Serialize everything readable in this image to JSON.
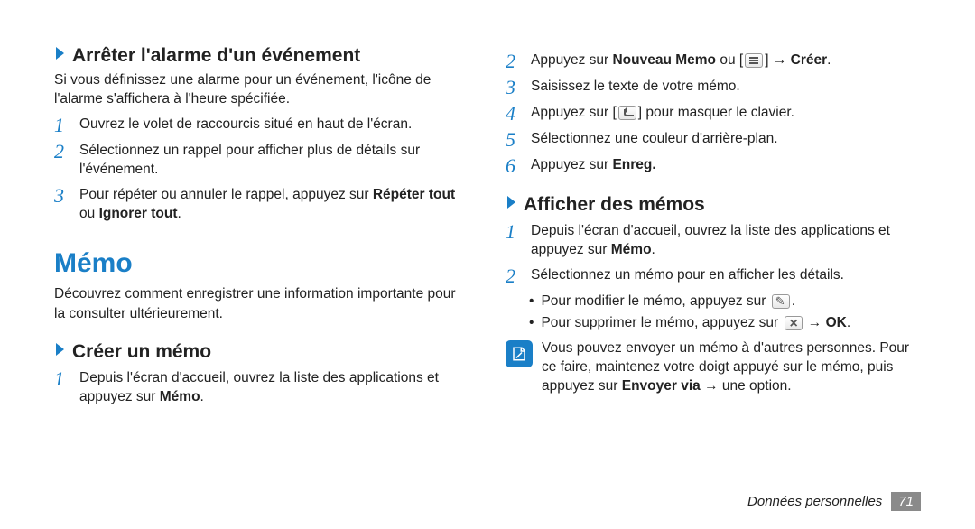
{
  "left": {
    "section1": {
      "heading": "Arrêter l'alarme d'un événement",
      "intro": "Si vous définissez une alarme pour un événement, l'icône de l'alarme s'affichera à l'heure spécifiée.",
      "steps": [
        {
          "num": "1",
          "text": "Ouvrez le volet de raccourcis situé en haut de l'écran."
        },
        {
          "num": "2",
          "text": "Sélectionnez un rappel pour afficher plus de détails sur l'événement."
        },
        {
          "num": "3",
          "prefix": "Pour répéter ou annuler le rappel, appuyez sur ",
          "bold1": "Répéter tout",
          "mid": " ou ",
          "bold2": "Ignorer tout",
          "suffix": "."
        }
      ]
    },
    "major": "Mémo",
    "majorIntro": "Découvrez comment enregistrer une information importante pour la consulter ultérieurement.",
    "section2": {
      "heading": "Créer un mémo",
      "steps": [
        {
          "num": "1",
          "prefix": "Depuis l'écran d'accueil, ouvrez la liste des applications et appuyez sur ",
          "bold1": "Mémo",
          "suffix": "."
        }
      ]
    }
  },
  "right": {
    "topSteps": [
      {
        "num": "2",
        "prefix": "Appuyez sur ",
        "bold1": "Nouveau Memo",
        "mid": " ou [",
        "icon": "menu",
        "mid2": "] → ",
        "bold2": "Créer",
        "suffix": "."
      },
      {
        "num": "3",
        "text": "Saisissez le texte de votre mémo."
      },
      {
        "num": "4",
        "prefix": "Appuyez sur [",
        "icon": "back",
        "suffix": "] pour masquer le clavier."
      },
      {
        "num": "5",
        "text": "Sélectionnez une couleur d'arrière-plan."
      },
      {
        "num": "6",
        "prefix": "Appuyez sur ",
        "bold1": "Enreg."
      }
    ],
    "section1": {
      "heading": "Afficher des mémos",
      "steps": [
        {
          "num": "1",
          "prefix": "Depuis l'écran d'accueil, ouvrez la liste des applications et appuyez sur ",
          "bold1": "Mémo",
          "suffix": "."
        },
        {
          "num": "2",
          "text": "Sélectionnez un mémo pour en afficher les détails."
        }
      ],
      "bullets": [
        {
          "prefix": "Pour modifier le mémo, appuyez sur ",
          "icon": "pencil",
          "suffix": "."
        },
        {
          "prefix": "Pour supprimer le mémo, appuyez sur ",
          "icon": "x",
          "mid": " → ",
          "bold1": "OK",
          "suffix": "."
        }
      ],
      "note": {
        "line1": "Vous pouvez envoyer un mémo à d'autres personnes. Pour ce faire, maintenez votre doigt appuyé sur le mémo, puis appuyez sur ",
        "bold1": "Envoyer via",
        "suffix": " → une option."
      }
    }
  },
  "footer": {
    "label": "Données personnelles",
    "page": "71"
  }
}
